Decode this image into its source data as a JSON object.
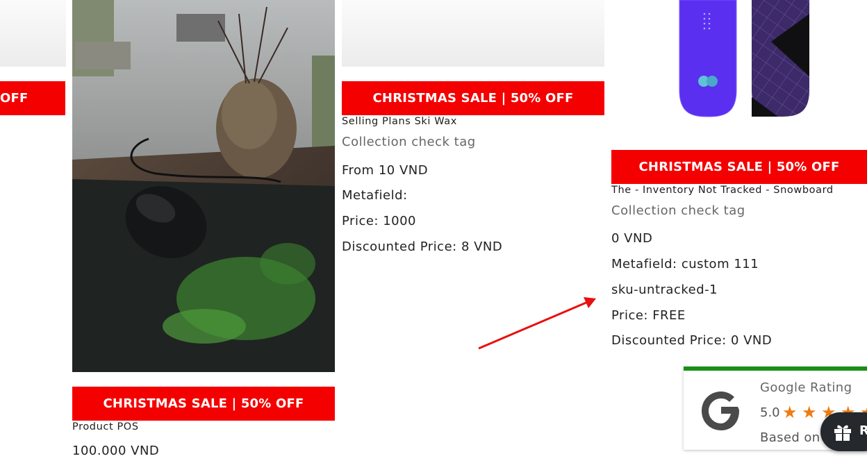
{
  "colors": {
    "sale_banner": "#f40000",
    "rating_accent": "#1a8f16",
    "star": "#ef7b10",
    "arrow": "#e81010"
  },
  "cards": [
    {
      "banner": "OFF"
    },
    {
      "banner": "CHRISTMAS SALE | 50% OFF",
      "title": "Product POS",
      "price": "100.000 VND"
    },
    {
      "banner": "CHRISTMAS SALE | 50% OFF",
      "title": "Selling Plans Ski Wax",
      "tag": "Collection check tag",
      "lines": [
        "From 10 VND",
        "Metafield:",
        "Price: 1000",
        "Discounted Price: 8 VND"
      ]
    },
    {
      "banner": "CHRISTMAS SALE | 50% OFF",
      "title": "The - Inventory Not Tracked - Snowboard",
      "tag": "Collection check tag",
      "lines": [
        "0 VND",
        "Metafield: custom 111",
        "sku-untracked-1",
        "Price: FREE",
        "Discounted Price: 0 VND"
      ]
    }
  ],
  "google_rating": {
    "title": "Google Rating",
    "score": "5.0",
    "stars": 5,
    "based_on": "Based on",
    "logo_letter": "G"
  },
  "reward_button": {
    "icon": "gift-icon",
    "label": "R"
  }
}
